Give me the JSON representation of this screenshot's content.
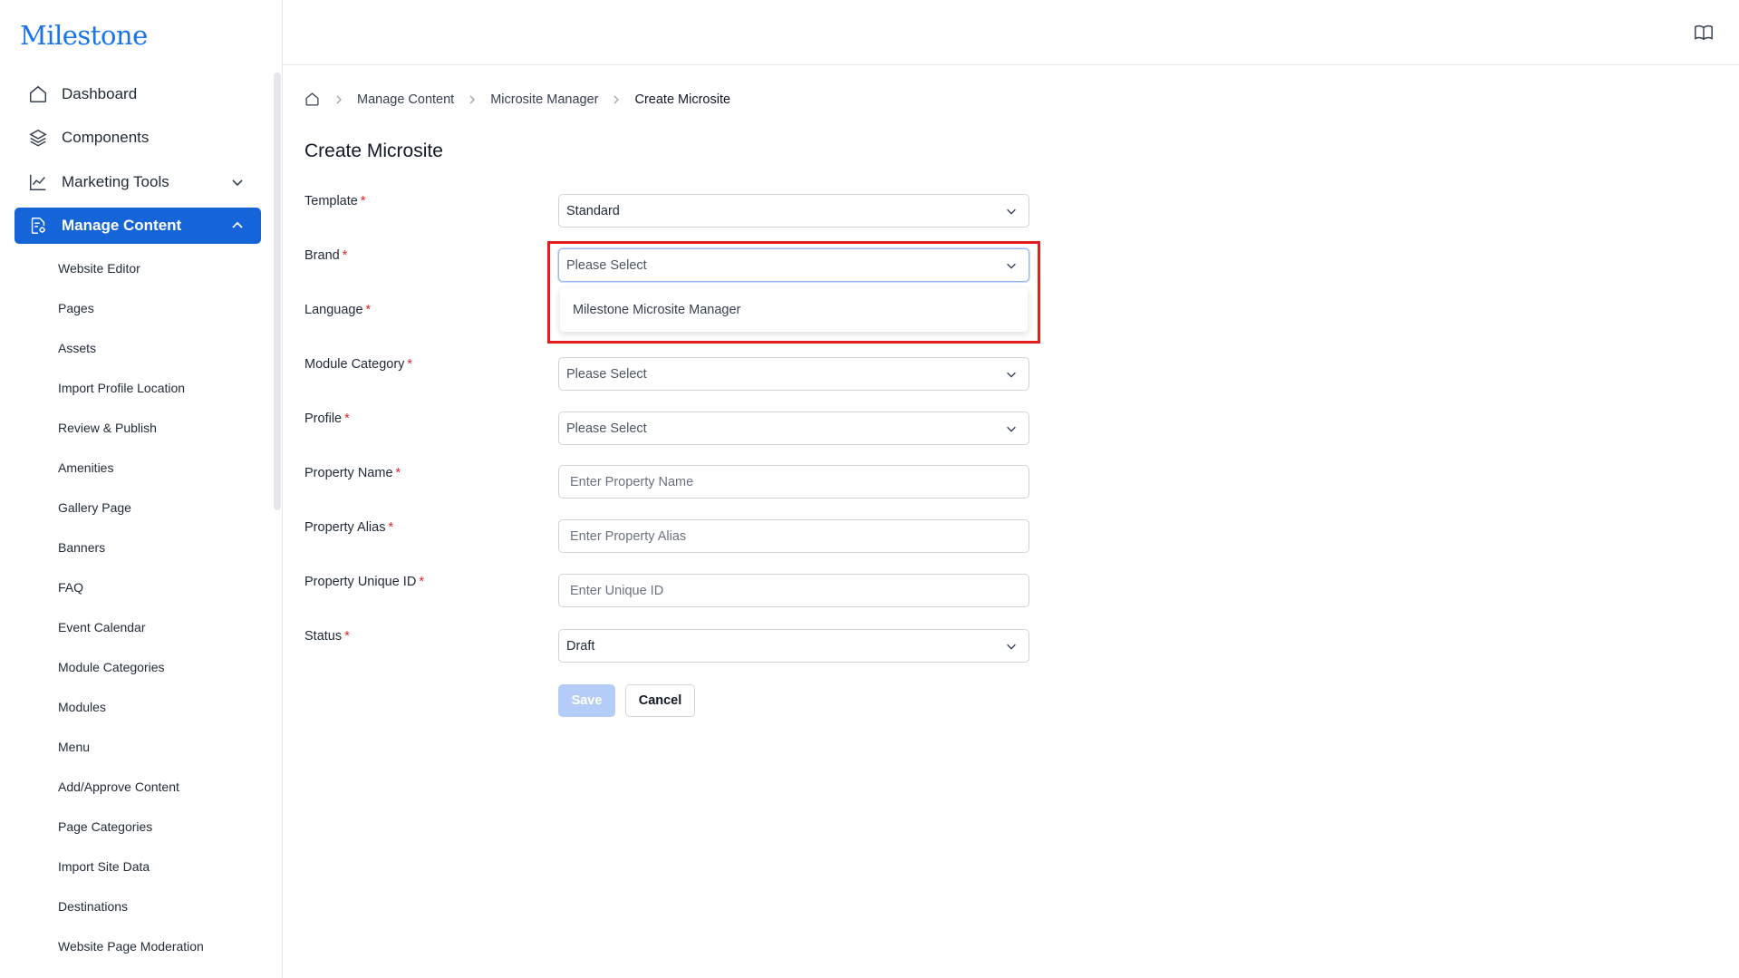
{
  "app": {
    "logo_text": "Milestone"
  },
  "sidebar": {
    "items": [
      {
        "label": "Dashboard",
        "icon": "home-icon"
      },
      {
        "label": "Components",
        "icon": "layers-icon"
      },
      {
        "label": "Marketing Tools",
        "icon": "chart-line-icon",
        "expandable": true,
        "expanded": false
      },
      {
        "label": "Manage Content",
        "icon": "document-settings-icon",
        "expandable": true,
        "expanded": true,
        "active": true
      }
    ],
    "sub_items": [
      "Website Editor",
      "Pages",
      "Assets",
      "Import Profile Location",
      "Review & Publish",
      "Amenities",
      "Gallery Page",
      "Banners",
      "FAQ",
      "Event Calendar",
      "Module Categories",
      "Modules",
      "Menu",
      "Add/Approve Content",
      "Page Categories",
      "Import Site Data",
      "Destinations",
      "Website Page Moderation"
    ]
  },
  "header": {
    "right_icon": "book-open-icon"
  },
  "breadcrumb": {
    "home_icon": "home-icon",
    "items": [
      "Manage Content",
      "Microsite Manager",
      "Create Microsite"
    ]
  },
  "page": {
    "title": "Create Microsite"
  },
  "form": {
    "required_mark": "*",
    "template": {
      "label": "Template",
      "value": "Standard"
    },
    "brand": {
      "label": "Brand",
      "placeholder": "Please Select",
      "open": true,
      "options": [
        "Milestone Microsite Manager"
      ]
    },
    "language": {
      "label": "Language"
    },
    "module_category": {
      "label": "Module Category",
      "placeholder": "Please Select"
    },
    "profile": {
      "label": "Profile",
      "placeholder": "Please Select"
    },
    "property_name": {
      "label": "Property Name",
      "placeholder": "Enter Property Name"
    },
    "property_alias": {
      "label": "Property Alias",
      "placeholder": "Enter Property Alias"
    },
    "property_unique_id": {
      "label": "Property Unique ID",
      "placeholder": "Enter Unique ID"
    },
    "status": {
      "label": "Status",
      "value": "Draft"
    },
    "save_label": "Save",
    "cancel_label": "Cancel"
  },
  "colors": {
    "accent": "#1565d8",
    "required": "#dc2626",
    "highlight": "#e11d1d",
    "save_disabled": "#b3cdf8"
  }
}
